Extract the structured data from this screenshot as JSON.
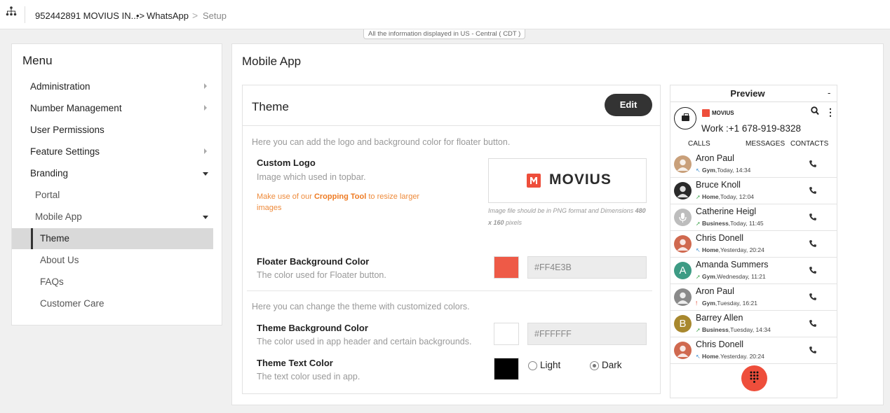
{
  "breadcrumb": {
    "account": "952442891 MOVIUS IN...",
    "app": "WhatsApp",
    "page": "Setup"
  },
  "timezone_note": "All the information displayed in US - Central ( CDT )",
  "menu": {
    "title": "Menu",
    "items": [
      {
        "label": "Administration",
        "chevron": "right"
      },
      {
        "label": "Number Management",
        "chevron": "right"
      },
      {
        "label": "User Permissions"
      },
      {
        "label": "Feature Settings",
        "chevron": "right"
      },
      {
        "label": "Branding",
        "chevron": "down"
      },
      {
        "label": "Portal"
      },
      {
        "label": "Mobile App",
        "chevron": "down"
      },
      {
        "label": "Theme",
        "active": true
      },
      {
        "label": "About Us"
      },
      {
        "label": "FAQs"
      },
      {
        "label": "Customer Care"
      }
    ]
  },
  "main": {
    "title": "Mobile App",
    "theme_card": {
      "title": "Theme",
      "edit_label": "Edit",
      "logo_intro": "Here you can add the logo and background color for floater button.",
      "custom_logo": {
        "label": "Custom Logo",
        "desc": "Image which used in topbar.",
        "crop_prefix": "Make use of our",
        "crop_link": "Cropping Tool",
        "crop_suffix": "to resize larger images",
        "logo_text": "MOVIUS",
        "hint_prefix": "Image file should be in PNG format and Dimensions",
        "hint_dims": "480 x 160",
        "hint_suffix": "pixels"
      },
      "floater": {
        "label": "Floater Background Color",
        "desc": "The color used for Floater button.",
        "value": "#FF4E3B",
        "swatch": "#ee5a47"
      },
      "theme_intro": "Here you can change the theme with customized colors.",
      "theme_bg": {
        "label": "Theme Background Color",
        "desc": "The color used in app header and certain backgrounds.",
        "value": "#FFFFFF",
        "swatch": "#ffffff"
      },
      "theme_text": {
        "label": "Theme Text Color",
        "desc": "The text color used in app.",
        "swatch": "#000000",
        "options": [
          "Light",
          "Dark"
        ],
        "selected": "Dark"
      }
    },
    "preview": {
      "title": "Preview",
      "minimize": "-",
      "brand": "MOVIUS",
      "work_line": "Work :+1 678-919-8328",
      "tabs": [
        "CALLS",
        "MESSAGES",
        "CONTACTS"
      ],
      "contacts": [
        {
          "name": "Aron Paul",
          "tag": "Gym",
          "time": ",Today, 14:34",
          "dir": "in",
          "avatar": "photo",
          "color": "#c9a07a"
        },
        {
          "name": "Bruce Knoll",
          "tag": "Home",
          "time": ",Today, 12:04",
          "dir": "out",
          "avatar": "photo",
          "color": "#2a2a2a"
        },
        {
          "name": "Catherine Heigl",
          "tag": "Business",
          "time": ",Today, 11:45",
          "dir": "out",
          "avatar": "mic",
          "color": "#bdbdbd"
        },
        {
          "name": "Chris Donell",
          "tag": "Home",
          "time": ",Yesterday, 20:24",
          "dir": "in",
          "avatar": "silhouette",
          "color": "#d0694f"
        },
        {
          "name": "Amanda Summers",
          "tag": "Gym",
          "time": ",Wednesday, 11:21",
          "dir": "out",
          "avatar": "A",
          "color": "#3d9b84"
        },
        {
          "name": "Aron Paul",
          "tag": "Gym",
          "time": ",Tuesday, 16:21",
          "dir": "missed",
          "avatar": "photo",
          "color": "#8a8a8a"
        },
        {
          "name": "Barrey Allen",
          "tag": "Business",
          "time": ",Tuesday, 14:34",
          "dir": "out",
          "avatar": "B",
          "color": "#a8882e"
        },
        {
          "name": "Chris Donell",
          "tag": "Home",
          "time": ".Yesterday. 20:24",
          "dir": "in",
          "avatar": "silhouette",
          "color": "#d0694f"
        }
      ],
      "fab_color": "#ee4e3b"
    }
  }
}
